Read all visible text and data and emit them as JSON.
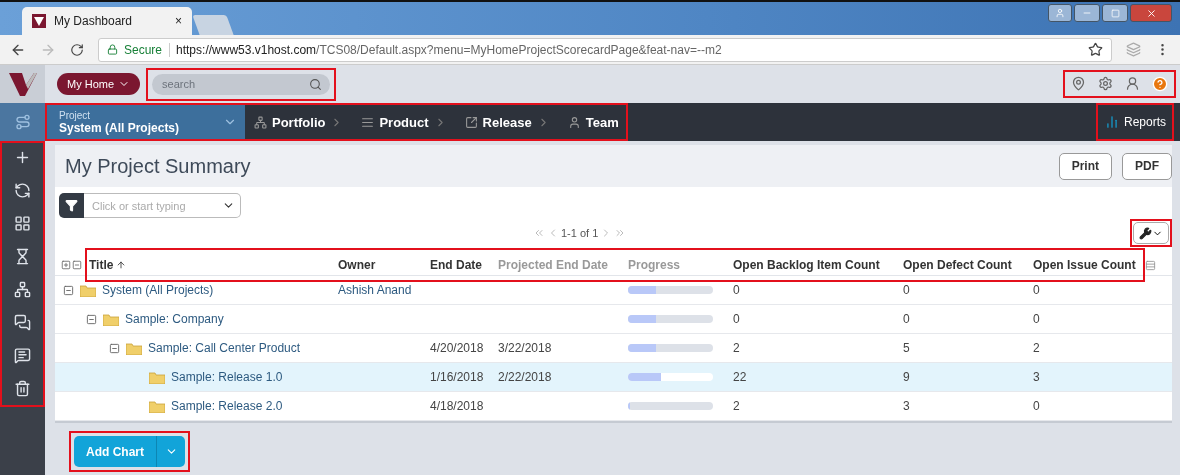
{
  "browser": {
    "tab_title": "My Dashboard",
    "tab_close": "×",
    "secure_label": "Secure",
    "url_host": "https://www53.v1host.com",
    "url_path": "/TCS08/Default.aspx?menu=MyHomeProjectScorecardPage&feat-nav=--m2"
  },
  "header": {
    "home_menu": "My Home",
    "search": {
      "placeholder": "search",
      "highlighted": true
    },
    "icons_highlighted": true
  },
  "nav": {
    "project_label": "Project",
    "project_value": "System (All Projects)",
    "highlighted": true,
    "items": [
      {
        "kind": "portfolio",
        "label": "Portfolio"
      },
      {
        "kind": "product",
        "label": "Product"
      },
      {
        "kind": "release",
        "label": "Release"
      },
      {
        "kind": "team",
        "label": "Team"
      }
    ],
    "reports": {
      "label": "Reports",
      "highlighted": true
    }
  },
  "sidebar": {
    "highlighted": true,
    "items": [
      {
        "kind": "add"
      },
      {
        "kind": "watch"
      },
      {
        "kind": "grid"
      },
      {
        "kind": "timer"
      },
      {
        "kind": "network"
      },
      {
        "kind": "chat"
      },
      {
        "kind": "note"
      },
      {
        "kind": "trash"
      }
    ]
  },
  "page": {
    "title": "My Project Summary",
    "buttons": [
      "Print",
      "PDF"
    ],
    "filter_placeholder": "Click or start typing",
    "pager": "1-1 of 1",
    "tools_highlighted": true
  },
  "table": {
    "columns_highlighted": true,
    "columns": [
      {
        "label": "Title",
        "dimmed": false
      },
      {
        "label": "Owner",
        "dimmed": false
      },
      {
        "label": "End Date",
        "dimmed": false
      },
      {
        "label": "Projected End Date",
        "dimmed": true
      },
      {
        "label": "Progress",
        "dimmed": true
      },
      {
        "label": "Open Backlog Item Count",
        "dimmed": false
      },
      {
        "label": "Open Defect Count",
        "dimmed": false
      },
      {
        "label": "Open Issue Count",
        "dimmed": false
      }
    ],
    "rows": [
      {
        "title": "System (All Projects)",
        "owner": "Ashish Anand",
        "level": 0.33,
        "backlog": "0",
        "defects": "0",
        "issues": "0",
        "selected": false,
        "expanded": true,
        "children": [
          {
            "title": "Sample: Company",
            "level": 0.33,
            "backlog": "0",
            "defects": "0",
            "issues": "0",
            "selected": false,
            "expanded": true,
            "children": [
              {
                "title": "Sample: Call Center Product",
                "end_date": "4/20/2018",
                "projected_end_date": "3/22/2018",
                "level": 0.33,
                "backlog": "2",
                "defects": "5",
                "issues": "2",
                "selected": false,
                "expanded": true,
                "children": [
                  {
                    "title": "Sample: Release 1.0",
                    "end_date": "1/16/2018",
                    "projected_end_date": "2/22/2018",
                    "level": 0.39,
                    "backlog": "22",
                    "defects": "9",
                    "issues": "3",
                    "selected": true
                  },
                  {
                    "title": "Sample: Release 2.0",
                    "end_date": "4/18/2018",
                    "level": 0.02,
                    "backlog": "2",
                    "defects": "3",
                    "issues": "0",
                    "selected": false
                  }
                ]
              }
            ]
          }
        ]
      }
    ]
  },
  "add_chart": {
    "label": "Add Chart",
    "highlighted": true
  }
}
